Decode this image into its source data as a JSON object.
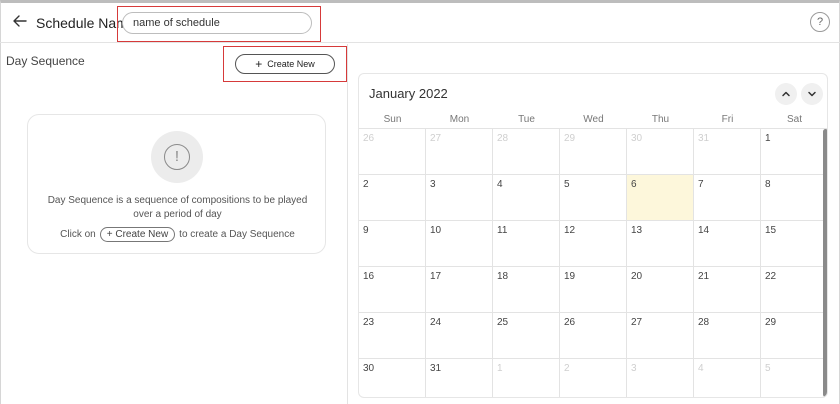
{
  "header": {
    "schedule_label": "Schedule Name",
    "name_value": "name of schedule",
    "help": "?"
  },
  "left": {
    "title": "Day Sequence",
    "create_button": "Create New",
    "empty_message": "Day Sequence is a sequence of compositions to be played over a period of day",
    "click_on": "Click on",
    "pill_label": "+ Create New",
    "to_create": "to create a Day Sequence"
  },
  "calendar": {
    "month_label": "January 2022",
    "weekdays": [
      "Sun",
      "Mon",
      "Tue",
      "Wed",
      "Thu",
      "Fri",
      "Sat"
    ],
    "weeks": [
      [
        "26",
        "27",
        "28",
        "29",
        "30",
        "31",
        "1"
      ],
      [
        "2",
        "3",
        "4",
        "5",
        "6",
        "7",
        "8"
      ],
      [
        "9",
        "10",
        "11",
        "12",
        "13",
        "14",
        "15"
      ],
      [
        "16",
        "17",
        "18",
        "19",
        "20",
        "21",
        "22"
      ],
      [
        "23",
        "24",
        "25",
        "26",
        "27",
        "28",
        "29"
      ],
      [
        "30",
        "31",
        "1",
        "2",
        "3",
        "4",
        "5"
      ]
    ],
    "other_month": [
      [
        true,
        true,
        true,
        true,
        true,
        true,
        false
      ],
      [
        false,
        false,
        false,
        false,
        false,
        false,
        false
      ],
      [
        false,
        false,
        false,
        false,
        false,
        false,
        false
      ],
      [
        false,
        false,
        false,
        false,
        false,
        false,
        false
      ],
      [
        false,
        false,
        false,
        false,
        false,
        false,
        false
      ],
      [
        false,
        false,
        true,
        true,
        true,
        true,
        true
      ]
    ],
    "today": "6",
    "highlight_color": "#fdf7db",
    "accent_color": "#d63a3a"
  },
  "icons": {
    "back": "arrow-left-icon",
    "alert": "alert-circle-icon",
    "up": "chevron-up-icon",
    "down": "chevron-down-icon"
  }
}
